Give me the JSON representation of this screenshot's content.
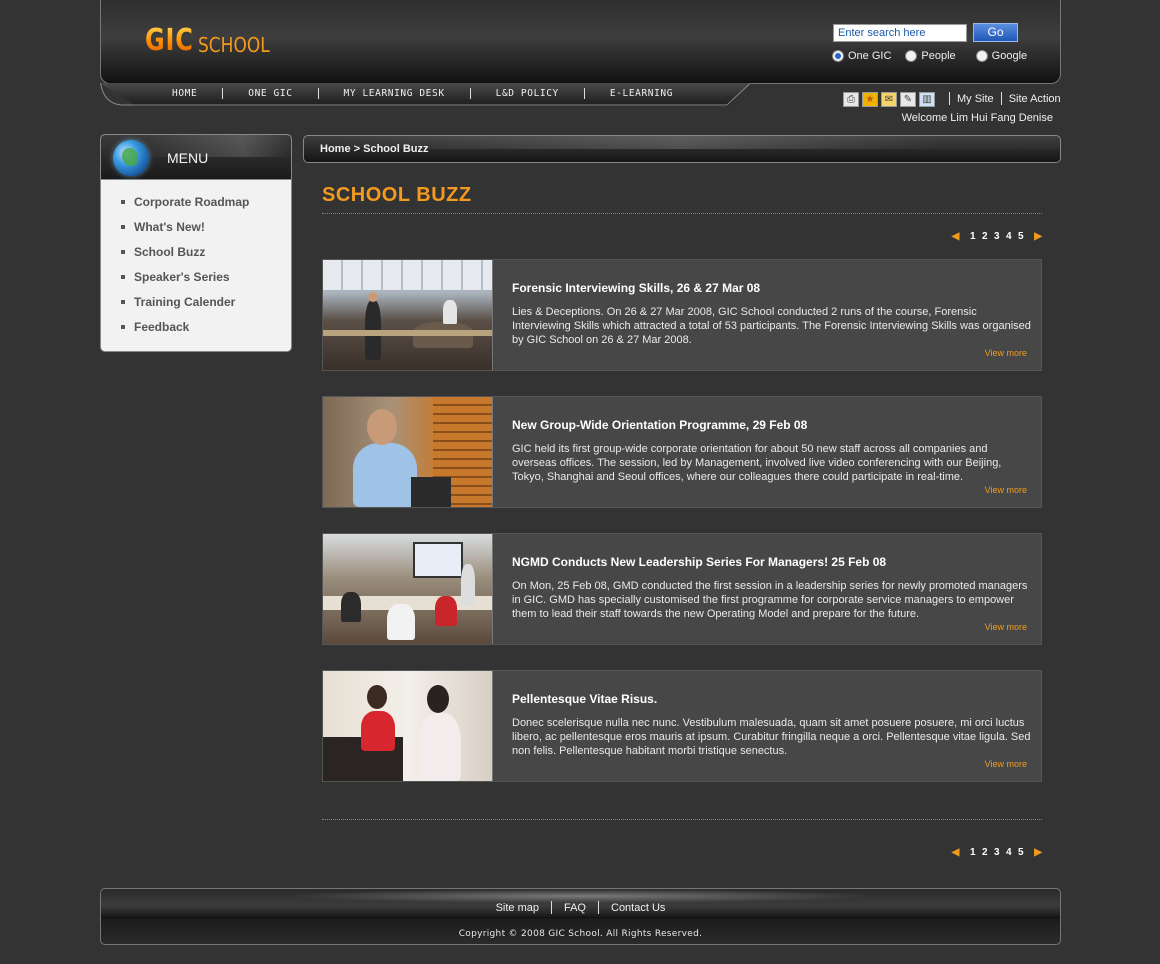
{
  "header": {
    "logo_gic": "GIC",
    "logo_school": "SCHOOL",
    "search_placeholder": "Enter search here",
    "go_label": "Go",
    "search_scopes": [
      {
        "label": "One GIC",
        "selected": true
      },
      {
        "label": "People",
        "selected": false
      },
      {
        "label": "Google",
        "selected": false
      }
    ]
  },
  "nav": {
    "items": [
      "HOME",
      "ONE GIC",
      "MY LEARNING DESK",
      "L&D POLICY",
      "E-LEARNING"
    ]
  },
  "tools": {
    "icons": [
      "print-icon",
      "bookmark-icon",
      "email-icon",
      "edit-icon",
      "delete-icon"
    ],
    "my_site": "My Site",
    "site_action": "Site Action",
    "welcome": "Welcome Lim Hui Fang Denise"
  },
  "sidebar": {
    "title": "MENU",
    "items": [
      "Corporate Roadmap",
      "What's New!",
      "School Buzz",
      "Speaker's Series",
      "Training Calender",
      "Feedback"
    ]
  },
  "breadcrumb": {
    "home": "Home",
    "separator": ">",
    "current": "School Buzz"
  },
  "page": {
    "title": "SCHOOL BUZZ",
    "pages": [
      "1",
      "2",
      "3",
      "4",
      "5"
    ]
  },
  "news": [
    {
      "title": "Forensic Interviewing Skills, 26 & 27 Mar 08",
      "body": "Lies & Deceptions. On 26 & 27 Mar 2008, GIC School conducted 2 runs of the course, Forensic Interviewing Skills which attracted a total of 53 participants. The Forensic Interviewing Skills was organised by GIC School on 26 & 27 Mar 2008.",
      "more": "View more"
    },
    {
      "title": "New Group-Wide Orientation Programme, 29 Feb 08",
      "body": "GIC held its first group-wide corporate orientation for about 50 new staff across all companies and overseas offices. The session,  led by Management, involved live video conferencing with our Beijing, Tokyo, Shanghai and Seoul offices, where our colleagues there could participate in real-time.",
      "more": "View more"
    },
    {
      "title": "NGMD Conducts New Leadership Series For Managers! 25 Feb 08",
      "body": "On Mon, 25 Feb 08, GMD conducted the first session in a leadership series for newly promoted managers in GIC. GMD has specially customised the first programme for corporate service managers to empower them to lead their staff towards the new Operating Model and prepare for the future.",
      "more": "View more"
    },
    {
      "title": "Pellentesque Vitae Risus.",
      "body": "Donec scelerisque nulla nec nunc. Vestibulum malesuada, quam sit amet posuere posuere, mi orci luctus libero, ac pellentesque eros mauris at ipsum. Curabitur fringilla neque a orci. Pellentesque vitae ligula. Sed non felis. Pellentesque habitant morbi tristique senectus.",
      "more": "View more"
    }
  ],
  "footer": {
    "links": [
      "Site map",
      "FAQ",
      "Contact Us"
    ],
    "copyright": "Copyright © 2008 GIC School. All Rights Reserved."
  },
  "colors": {
    "background": "#333333",
    "accent": "#f39a1f",
    "card": "#474747",
    "go_button": "#1e57b8"
  }
}
